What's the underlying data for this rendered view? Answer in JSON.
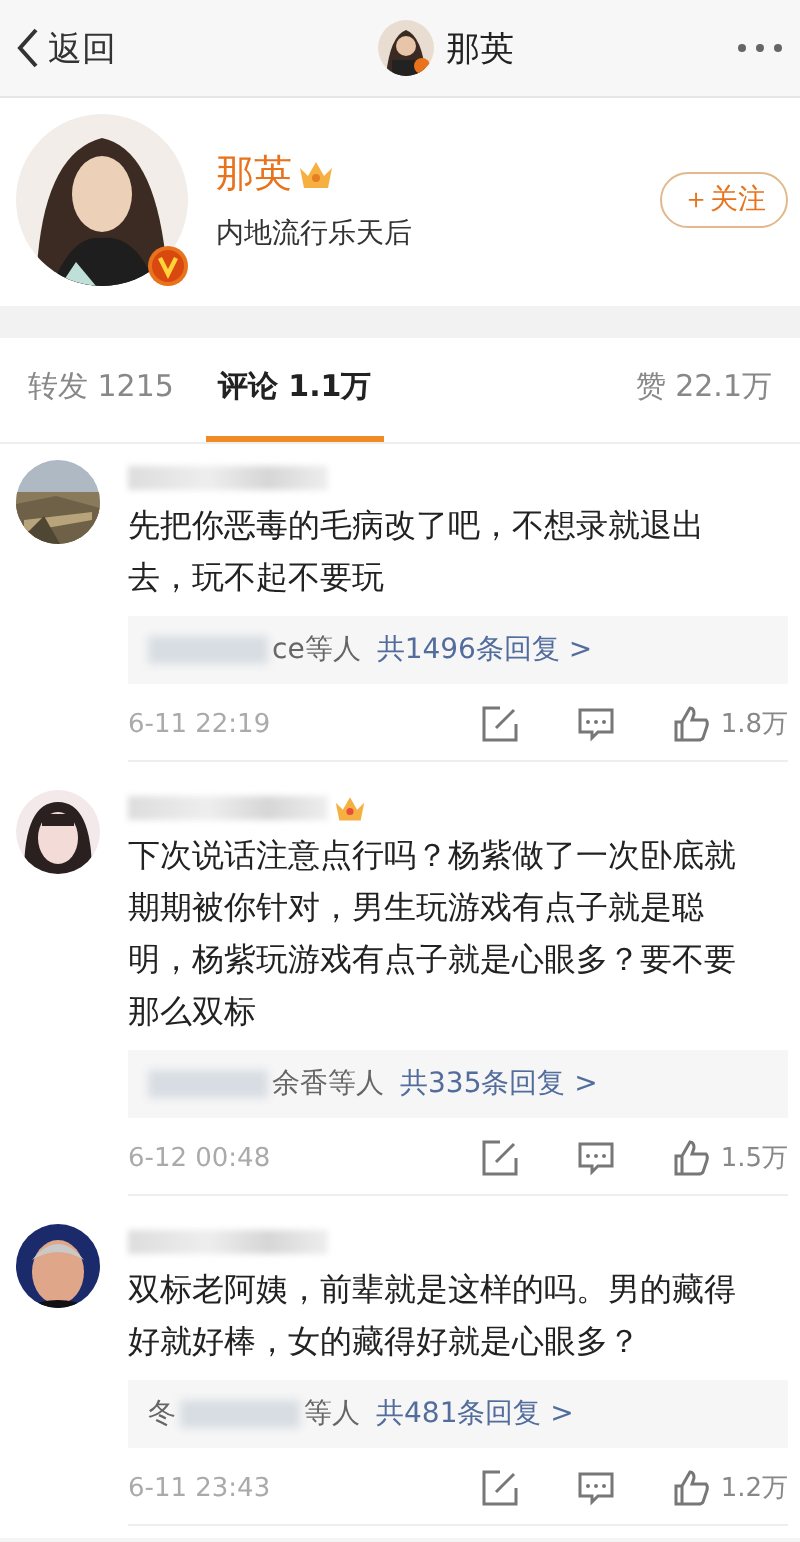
{
  "header": {
    "back_label": "返回",
    "title": "那英"
  },
  "profile": {
    "name": "那英",
    "subtitle": "内地流行乐天后",
    "follow_button": "＋关注"
  },
  "tabs": [
    {
      "label": "转发 1215",
      "selected": false
    },
    {
      "label": "评论 1.1万",
      "selected": true
    },
    {
      "label": "赞 22.1万",
      "selected": false
    }
  ],
  "comments": [
    {
      "crown": false,
      "text": "先把你恶毒的毛病改了吧，不想录就退出去，玩不起不要玩",
      "reply": {
        "names": "ce等人",
        "total": "共1496条回复 >"
      },
      "time": "6-11 22:19",
      "likes": "1.8万"
    },
    {
      "crown": true,
      "text": "下次说话注意点行吗？杨紫做了一次卧底就期期被你针对，男生玩游戏有点子就是聪明，杨紫玩游戏有点子就是心眼多？要不要那么双标",
      "reply": {
        "names": "余香等人",
        "total": "共335条回复 >"
      },
      "time": "6-12 00:48",
      "likes": "1.5万"
    },
    {
      "crown": false,
      "text": "双标老阿姨，前辈就是这样的吗。男的藏得好就好棒，女的藏得好就是心眼多？",
      "reply": {
        "lead": "冬",
        "names": "等人",
        "total": "共481条回复 >"
      },
      "time": "6-11 23:43",
      "likes": "1.2万"
    }
  ]
}
